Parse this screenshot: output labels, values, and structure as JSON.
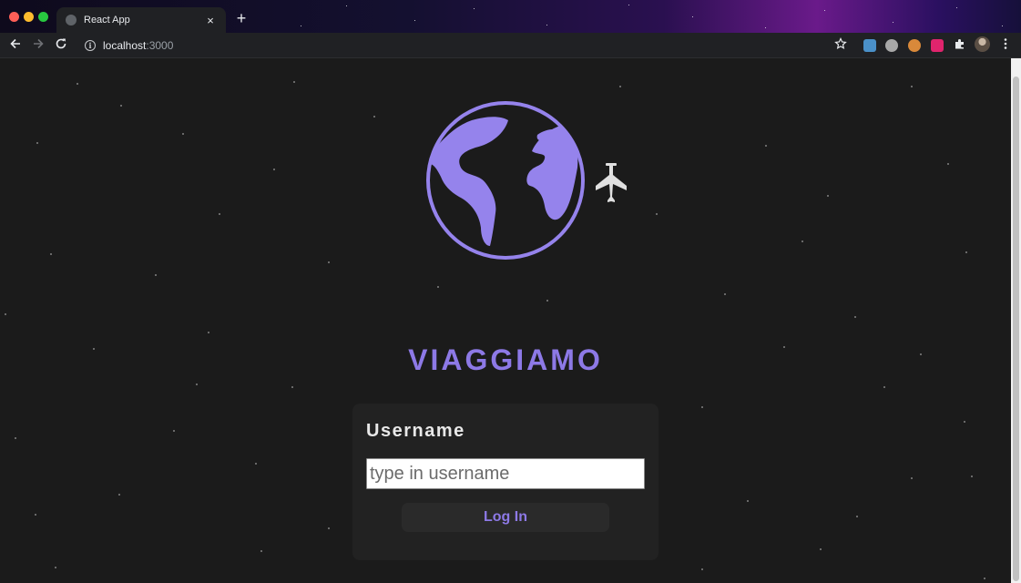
{
  "browser": {
    "tab_title": "React App",
    "tab_close": "×",
    "new_tab": "+",
    "url_host": "localhost",
    "url_port": ":3000",
    "icons": [
      "back-icon",
      "forward-icon",
      "reload-icon",
      "info-icon",
      "star-icon",
      "puzzle-icon",
      "kebab-menu-icon"
    ]
  },
  "app": {
    "brand": "VIAGGIAMO",
    "form": {
      "username_label": "Username",
      "username_placeholder": "type in username",
      "username_value": "",
      "login_label": "Log In"
    },
    "colors": {
      "accent": "#8d79e6",
      "background": "#1b1b1b",
      "card": "#222222"
    }
  }
}
